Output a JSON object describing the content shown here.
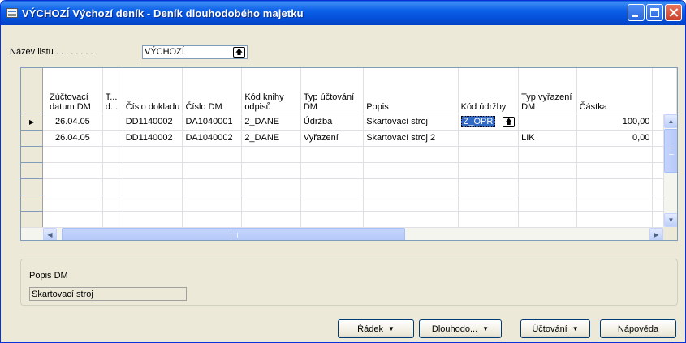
{
  "window": {
    "title": "VÝCHOZÍ Výchozí deník - Deník dlouhodobého majetku"
  },
  "sheet": {
    "label": "Název listu . . . . . . . .",
    "value": "VÝCHOZÍ"
  },
  "columns": [
    "Zúčtovací datum DM",
    "T... d...",
    "Číslo dokladu",
    "Číslo DM",
    "Kód knihy odpisů",
    "Typ účtování DM",
    "Popis",
    "Kód údržby",
    "Typ vyřazení DM",
    "Částka"
  ],
  "rows": [
    {
      "date": "26.04.05",
      "t": "",
      "doc": "DD1140002",
      "fa": "DA1040001",
      "book": "2_DANE",
      "post_type": "Údržba",
      "desc": "Skartovací stroj",
      "maint": "Z_OPR",
      "disposal": "",
      "amount": "100,00"
    },
    {
      "date": "26.04.05",
      "t": "",
      "doc": "DD1140002",
      "fa": "DA1040002",
      "book": "2_DANE",
      "post_type": "Vyřazení",
      "desc": "Skartovací stroj 2",
      "maint": "",
      "disposal": "LIK",
      "amount": "0,00"
    }
  ],
  "detail": {
    "label": "Popis DM",
    "value": "Skartovací stroj"
  },
  "buttons": {
    "line": "Řádek",
    "fa": "Dlouhodo...",
    "posting": "Účtování",
    "help": "Nápověda"
  },
  "icons": {
    "app": "journal-icon",
    "lookup": "lookup-arrow-icon",
    "row_pointer": "row-pointer-icon"
  }
}
